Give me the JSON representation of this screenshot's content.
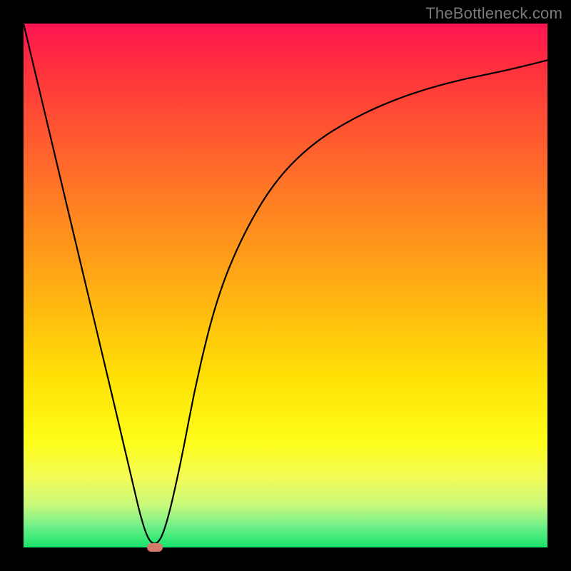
{
  "watermark": "TheBottleneck.com",
  "chart_data": {
    "type": "line",
    "title": "",
    "xlabel": "",
    "ylabel": "",
    "xlim": [
      0,
      100
    ],
    "ylim": [
      0,
      100
    ],
    "series": [
      {
        "name": "bottleneck-curve",
        "x": [
          0,
          5,
          10,
          15,
          20,
          23,
          25,
          27,
          30,
          33,
          37,
          42,
          48,
          55,
          63,
          72,
          82,
          92,
          100
        ],
        "values": [
          100,
          79,
          58,
          37,
          16,
          3,
          0,
          3,
          16,
          32,
          48,
          60,
          70,
          77,
          82,
          86,
          89,
          91,
          93
        ]
      }
    ],
    "annotations": [
      {
        "name": "optimal-marker",
        "x": 25,
        "y": 0,
        "color": "#d67a6a"
      }
    ],
    "background_gradient": {
      "top": "#ff1452",
      "mid": "#ffe205",
      "bottom": "#15e36a"
    }
  }
}
